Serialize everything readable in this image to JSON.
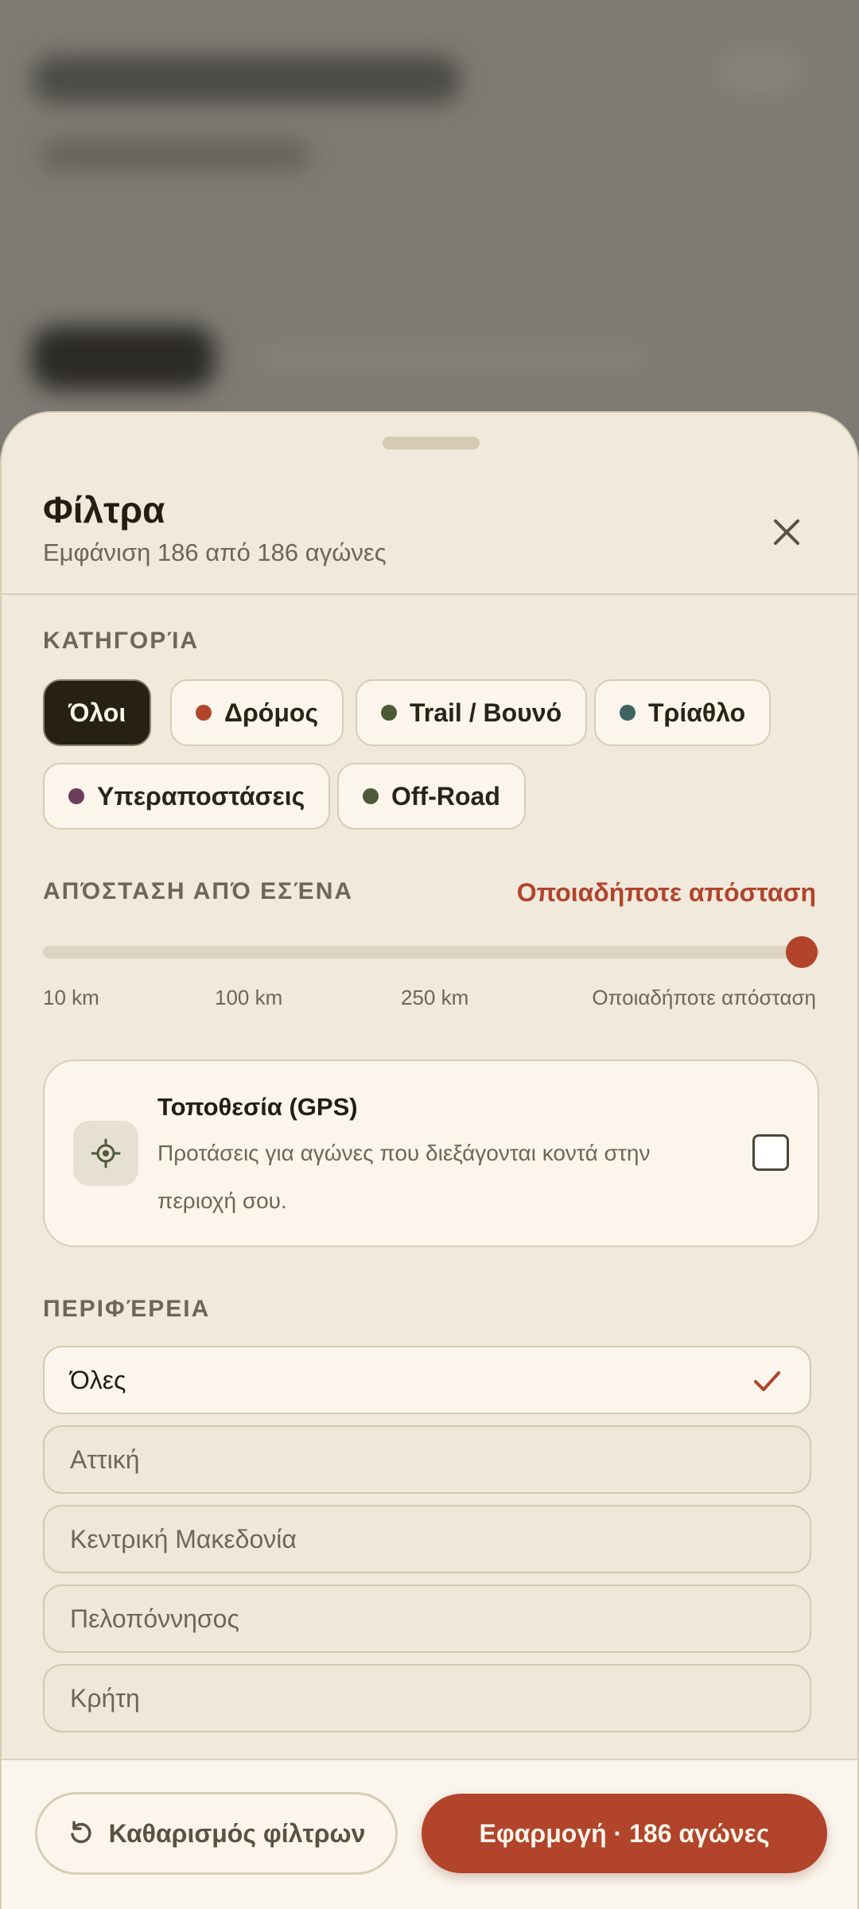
{
  "header": {
    "title": "Φίλτρα",
    "subtitle": "Εμφάνιση 186 από 186 αγώνες"
  },
  "category": {
    "label": "ΚΑΤΗΓΟΡΊΑ",
    "chips": [
      {
        "label": "Όλοι",
        "active": true,
        "dot_color": ""
      },
      {
        "label": "Δρόμος",
        "active": false,
        "dot_color": "#b1442a"
      },
      {
        "label": "Trail / Βουνό",
        "active": false,
        "dot_color": "#4d5a37"
      },
      {
        "label": "Τρίαθλο",
        "active": false,
        "dot_color": "#3f6361"
      },
      {
        "label": "Υπεραποστάσεις",
        "active": false,
        "dot_color": "#6d3e5c"
      },
      {
        "label": "Off-Road",
        "active": false,
        "dot_color": "#4d5a37"
      }
    ]
  },
  "distance": {
    "label": "ΑΠΌΣΤΑΣΗ ΑΠΌ ΕΣΈΝΑ",
    "value": "Οποιαδήποτε απόσταση",
    "slider_position": 1.0,
    "ticks": [
      "10 km",
      "100 km",
      "250 km",
      "Οποιαδήποτε απόσταση"
    ]
  },
  "gps": {
    "title": "Τοποθεσία (GPS)",
    "description": "Προτάσεις για αγώνες που διεξάγονται κοντά στην περιοχή σου.",
    "checked": false,
    "icon": "location-crosshair-icon"
  },
  "region": {
    "label": "ΠΕΡΙΦΈΡΕΙΑ",
    "options": [
      {
        "label": "Όλες",
        "selected": true
      },
      {
        "label": "Αττική",
        "selected": false
      },
      {
        "label": "Κεντρική Μακεδονία",
        "selected": false
      },
      {
        "label": "Πελοπόννησος",
        "selected": false
      },
      {
        "label": "Κρήτη",
        "selected": false
      }
    ]
  },
  "footer": {
    "clear_label": "Καθαρισμός φίλτρων",
    "apply_label": "Εφαρμογή · 186 αγώνες"
  },
  "colors": {
    "accent": "#b1442a",
    "sheet_bg": "#f0e9dc",
    "text_dark": "#231d12"
  }
}
